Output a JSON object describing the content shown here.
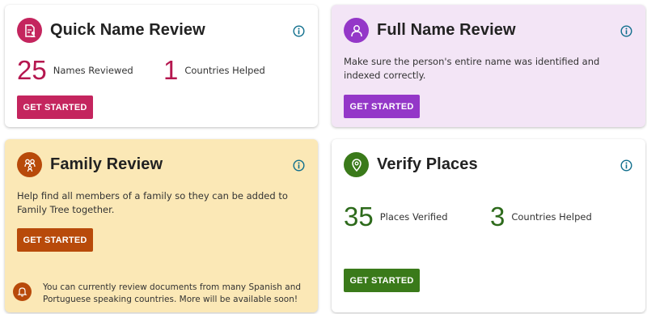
{
  "colors": {
    "quick_name_review_accent": "#c4255e",
    "full_name_review_accent": "#9437c8",
    "family_review_accent": "#b84a0a",
    "verify_places_accent": "#3a7a1a",
    "info_icon": "#0f6e8c"
  },
  "quick_name_review": {
    "title": "Quick Name Review",
    "icon": "document-person-icon",
    "stats": [
      {
        "value": "25",
        "label": "Names Reviewed"
      },
      {
        "value": "1",
        "label": "Countries Helped"
      }
    ],
    "button": "GET STARTED"
  },
  "full_name_review": {
    "title": "Full Name Review",
    "icon": "person-icon",
    "description": "Make sure the person's entire name was identified and indexed correctly.",
    "button": "GET STARTED"
  },
  "family_review": {
    "title": "Family Review",
    "icon": "family-icon",
    "description": "Help find all members of a family so they can be added to Family Tree together.",
    "button": "GET STARTED",
    "notice": "You can currently review documents from many Spanish and Portuguese speaking countries. More will be available soon!",
    "notice_icon": "bell-icon"
  },
  "verify_places": {
    "title": "Verify Places",
    "icon": "map-pin-icon",
    "stats": [
      {
        "value": "35",
        "label": "Places Verified"
      },
      {
        "value": "3",
        "label": "Countries Helped"
      }
    ],
    "button": "GET STARTED"
  }
}
